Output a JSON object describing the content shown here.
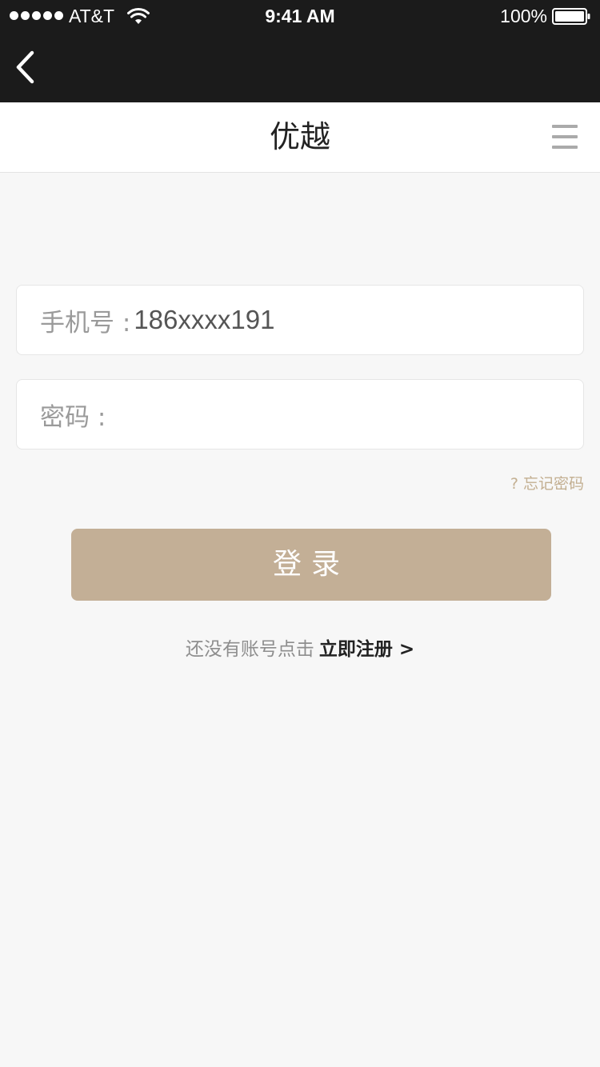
{
  "status_bar": {
    "carrier": "AT&T",
    "time": "9:41 AM",
    "battery_percent": "100%",
    "signal_bars": 5,
    "battery_level": 1.0
  },
  "header": {
    "title": "优越",
    "back_icon": "chevron-left-icon",
    "menu_icon": "hamburger-menu-icon"
  },
  "form": {
    "phone": {
      "label": "手机号 :",
      "value": "186xxxx191"
    },
    "password": {
      "label": "密码 :",
      "value": ""
    },
    "forgot_password": "? 忘记密码",
    "login_button": "登录"
  },
  "register": {
    "prompt": "还没有账号点击",
    "link": "立即注册 >"
  },
  "colors": {
    "accent": "#c3af96",
    "link_accent": "#c3af91",
    "dark_bar": "#1b1b1b",
    "background": "#f7f7f7"
  }
}
